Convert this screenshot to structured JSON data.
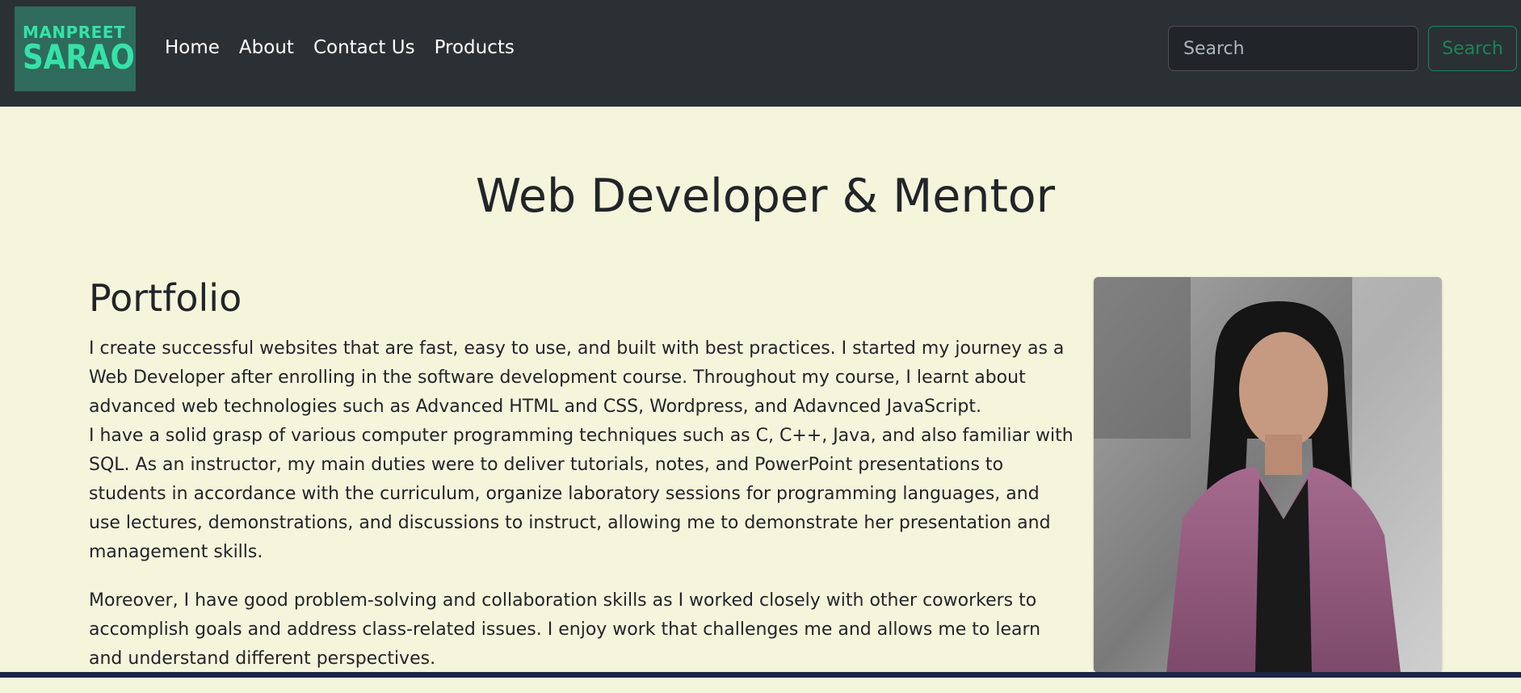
{
  "brand": {
    "logo_line1": "MANPREET",
    "logo_line2": "SARAO"
  },
  "nav": {
    "links": [
      "Home",
      "About",
      "Contact Us",
      "Products"
    ]
  },
  "search": {
    "placeholder": "Search",
    "button_label": "Search"
  },
  "main": {
    "heading": "Web Developer & Mentor",
    "section_title": "Portfolio",
    "paragraph1_line1": "I create successful websites that are fast, easy to use, and built with best practices. I started my journey as a Web Developer after enrolling in the software development course. Throughout my course, I learnt about advanced web technologies such as Advanced HTML and CSS, Wordpress, and Adavnced JavaScript.",
    "paragraph1_line2": "I have a solid grasp of various computer programming techniques such as C, C++, Java, and also familiar with SQL. As an instructor, my main duties were to deliver tutorials, notes, and PowerPoint presentations to students in accordance with the curriculum, organize laboratory sessions for programming languages, and use lectures, demonstrations, and discussions to instruct, allowing me to demonstrate her presentation and management skills.",
    "paragraph2": "Moreover, I have good problem-solving and collaboration skills as I worked closely with other coworkers to accomplish goals and address class-related issues. I enjoy work that challenges me and allows me to learn and understand different perspectives."
  },
  "colors": {
    "navbar_bg": "#2b3035",
    "page_bg": "#f5f5dc",
    "logo_accent": "#35e2a8",
    "search_button": "#198754"
  }
}
